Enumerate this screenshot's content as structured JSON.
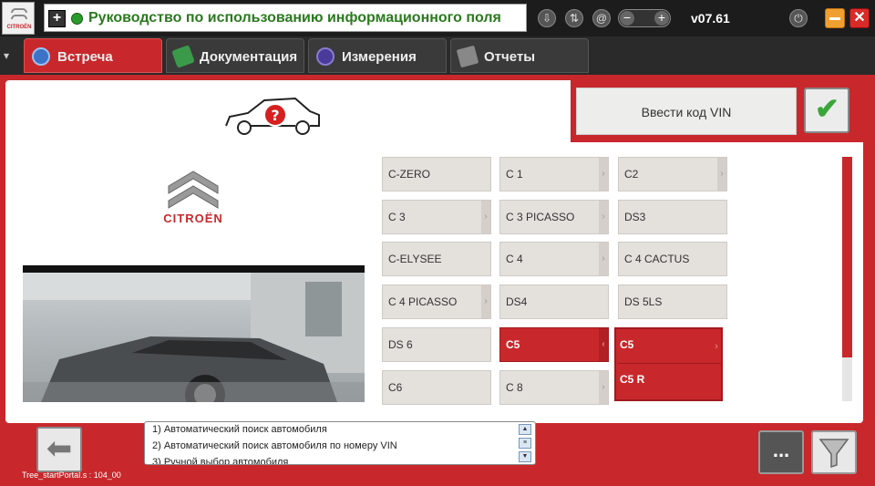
{
  "header": {
    "title": "Руководство по использованию информационного поля",
    "version": "v07.61",
    "logo_text": "CITROËN"
  },
  "tabs": [
    {
      "label": "Встреча",
      "active": true
    },
    {
      "label": "Документация",
      "active": false
    },
    {
      "label": "Измерения",
      "active": false
    },
    {
      "label": "Отчеты",
      "active": false
    }
  ],
  "vin": {
    "button_label": "Ввести код VIN"
  },
  "brand": {
    "name": "CITROËN"
  },
  "models": [
    [
      "C-ZERO",
      "C 1",
      "C2"
    ],
    [
      "C 3",
      "C 3 PICASSO",
      "DS3"
    ],
    [
      "C-ELYSEE",
      "C 4",
      "C 4 CACTUS"
    ],
    [
      "C 4 PICASSO",
      "DS4",
      "DS 5LS"
    ],
    [
      "DS 6",
      "C5",
      "C5"
    ],
    [
      "C6",
      "C 8",
      ""
    ]
  ],
  "submenu": [
    "C5",
    "C5 R"
  ],
  "help_lines": [
    "1) Автоматический поиск автомобиля",
    "2) Автоматический поиск автомобиля по номеру VIN",
    "3) Ручной выбор автомобиля"
  ],
  "footer": {
    "code": "Tree_startPortal.s : 104_00",
    "more_label": "..."
  },
  "colors": {
    "accent": "#c8282c",
    "title_green": "#2a7a1e"
  }
}
